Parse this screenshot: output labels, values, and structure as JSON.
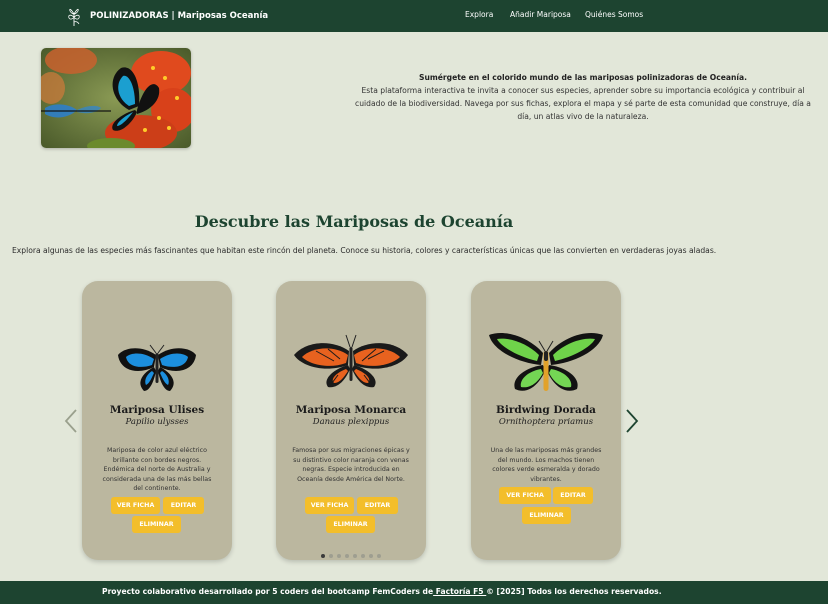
{
  "colors": {
    "nav_bg": "#1d4430",
    "page_bg": "#e2e7d9",
    "card_bg": "#bbb79f",
    "button_bg": "#f3be2b",
    "title_color": "#1d4430"
  },
  "navbar": {
    "logo_icon": "butterfly-flower-icon",
    "brand": "POLINIZADORAS | Mariposas Oceanía",
    "links": [
      "Explora",
      "Añadir Mariposa",
      "Quiénes Somos"
    ]
  },
  "hero": {
    "image_icon": "blue-butterfly-on-red-flowers-photo",
    "intro_heading": "Sumérgete en el colorido mundo de las mariposas polinizadoras de Oceanía.",
    "intro_body": "Esta plataforma interactiva te invita a conocer sus especies, aprender sobre su importancia ecológica y contribuir al cuidado de la biodiversidad. Navega por sus fichas, explora el mapa y sé parte de esta comunidad que construye, día a día, un atlas vivo de la naturaleza."
  },
  "gallery": {
    "title": "Descubre las Mariposas de Oceanía",
    "description": "Explora algunas de las especies más fascinantes que habitan este rincón del planeta. Conoce su historia, colores y características únicas que las convierten en verdaderas joyas aladas.",
    "prev_icon": "chevron-left-icon",
    "next_icon": "chevron-right-icon",
    "cards": [
      {
        "name": "Mariposa Ulises",
        "scientific": "Papilio ulysses",
        "description": "Mariposa de color azul eléctrico brillante con bordes negros. Endémica del norte de Australia y considerada una de las más bellas del continente.",
        "image_icon": "blue-black-butterfly-icon",
        "view_label": "VER FICHA",
        "edit_label": "EDITAR",
        "delete_label": "ELIMINAR"
      },
      {
        "name": "Mariposa Monarca",
        "scientific": "Danaus plexippus",
        "description": "Famosa por sus migraciones épicas y su distintivo color naranja con venas negras. Especie introducida en Oceanía desde América del Norte.",
        "image_icon": "orange-monarch-butterfly-icon",
        "view_label": "VER FICHA",
        "edit_label": "EDITAR",
        "delete_label": "ELIMINAR"
      },
      {
        "name": "Birdwing Dorada",
        "scientific": "Ornithoptera priamus",
        "description": "Una de las mariposas más grandes del mundo. Los machos tienen colores verde esmeralda y dorado vibrantes.",
        "image_icon": "green-birdwing-butterfly-icon",
        "view_label": "VER FICHA",
        "edit_label": "EDITAR",
        "delete_label": "ELIMINAR"
      }
    ],
    "pagination": {
      "pages": 8,
      "active": 1
    }
  },
  "footer": {
    "text_before": "Proyecto colaborativo desarrollado por 5 coders del bootcamp FemCoders de",
    "link": " Factoría F5 ",
    "text_after": "© [2025] Todos los derechos reservados."
  }
}
